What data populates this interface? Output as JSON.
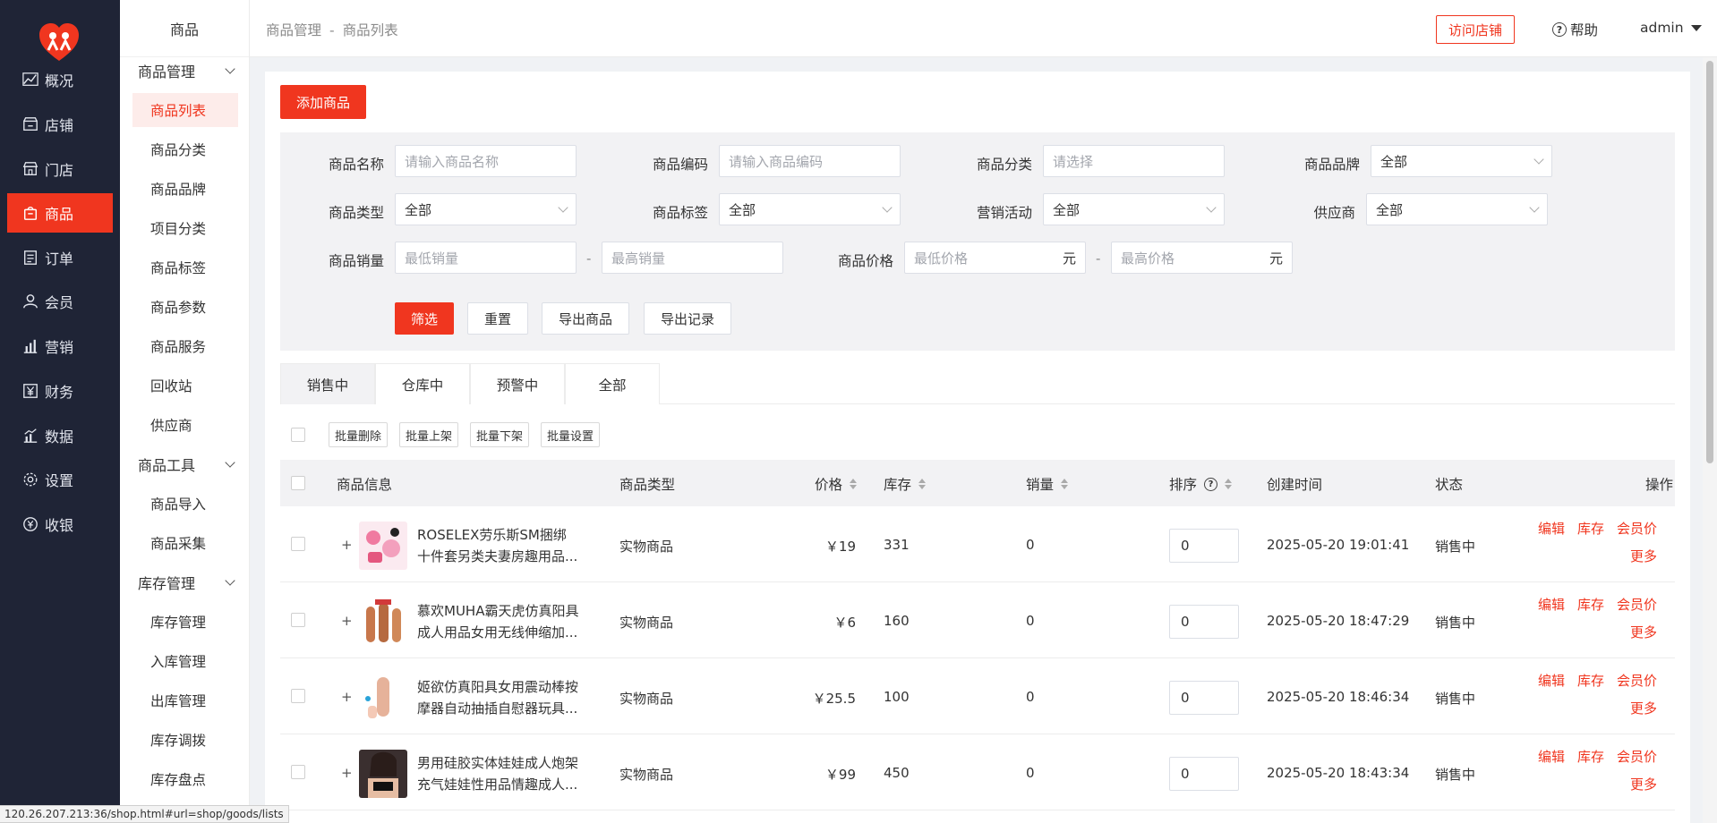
{
  "nav": {
    "items": [
      {
        "label": "概况",
        "icon": "chart-line-icon"
      },
      {
        "label": "店铺",
        "icon": "store-icon"
      },
      {
        "label": "门店",
        "icon": "shop-front-icon"
      },
      {
        "label": "商品",
        "icon": "bag-icon"
      },
      {
        "label": "订单",
        "icon": "order-list-icon"
      },
      {
        "label": "会员",
        "icon": "user-icon"
      },
      {
        "label": "营销",
        "icon": "bar-chart-icon"
      },
      {
        "label": "财务",
        "icon": "yen-icon"
      },
      {
        "label": "数据",
        "icon": "data-icon"
      },
      {
        "label": "设置",
        "icon": "gear-icon"
      },
      {
        "label": "收银",
        "icon": "cashier-icon"
      }
    ],
    "active_index": 3,
    "accent": "#f0361f",
    "background": "#1f2436"
  },
  "subnav": {
    "title": "商品",
    "groups": [
      {
        "label": "商品管理",
        "items": [
          "商品列表",
          "商品分类",
          "商品品牌",
          "项目分类",
          "商品标签",
          "商品参数",
          "商品服务",
          "回收站",
          "供应商"
        ]
      },
      {
        "label": "商品工具",
        "items": [
          "商品导入",
          "商品采集"
        ]
      },
      {
        "label": "库存管理",
        "items": [
          "库存管理",
          "入库管理",
          "出库管理",
          "库存调拨",
          "库存盘点"
        ]
      }
    ],
    "active_item": "商品列表"
  },
  "topbar": {
    "breadcrumb": [
      "商品管理",
      "商品列表"
    ],
    "breadcrumb_sep": "-",
    "visit_store": "访问店铺",
    "help": "帮助",
    "user": "admin"
  },
  "actions": {
    "add_goods": "添加商品"
  },
  "filter": {
    "name": {
      "label": "商品名称",
      "placeholder": "请输入商品名称"
    },
    "code": {
      "label": "商品编码",
      "placeholder": "请输入商品编码"
    },
    "category": {
      "label": "商品分类",
      "placeholder": "请选择"
    },
    "brand": {
      "label": "商品品牌",
      "value": "全部"
    },
    "type": {
      "label": "商品类型",
      "value": "全部"
    },
    "tag": {
      "label": "商品标签",
      "value": "全部"
    },
    "promotion": {
      "label": "营销活动",
      "value": "全部"
    },
    "supplier": {
      "label": "供应商",
      "value": "全部"
    },
    "sales": {
      "label": "商品销量",
      "min_placeholder": "最低销量",
      "max_placeholder": "最高销量"
    },
    "price": {
      "label": "商品价格",
      "min_placeholder": "最低价格",
      "max_placeholder": "最高价格",
      "unit": "元"
    },
    "range_sep": "-",
    "buttons": {
      "filter": "筛选",
      "reset": "重置",
      "export_goods": "导出商品",
      "export_records": "导出记录"
    }
  },
  "tabs": [
    "销售中",
    "仓库中",
    "预警中",
    "全部"
  ],
  "active_tab": "销售中",
  "batch": [
    "批量删除",
    "批量上架",
    "批量下架",
    "批量设置"
  ],
  "table": {
    "headers": {
      "info": "商品信息",
      "type": "商品类型",
      "price": "价格",
      "stock": "库存",
      "sales": "销量",
      "sort": "排序",
      "created": "创建时间",
      "status": "状态",
      "ops": "操作"
    },
    "rows": [
      {
        "name_line1": "ROSELEX劳乐斯SM捆绑",
        "name_line2": "十件套另类夫妻房趣用品...",
        "type": "实物商品",
        "price": "￥19",
        "stock": "331",
        "sales": "0",
        "sort": "0",
        "created": "2025-05-20 19:01:41",
        "status": "销售中"
      },
      {
        "name_line1": "慕欢MUHA霸天虎仿真阳具",
        "name_line2": "成人用品女用无线伸缩加...",
        "type": "实物商品",
        "price": "￥6",
        "stock": "160",
        "sales": "0",
        "sort": "0",
        "created": "2025-05-20 18:47:29",
        "status": "销售中"
      },
      {
        "name_line1": "姬欲仿真阳具女用震动棒按",
        "name_line2": "摩器自动抽插自慰器玩具...",
        "type": "实物商品",
        "price": "￥25.5",
        "stock": "100",
        "sales": "0",
        "sort": "0",
        "created": "2025-05-20 18:46:34",
        "status": "销售中"
      },
      {
        "name_line1": "男用硅胶实体娃娃成人炮架",
        "name_line2": "充气娃娃性用品情趣成人...",
        "type": "实物商品",
        "price": "￥99",
        "stock": "450",
        "sales": "0",
        "sort": "0",
        "created": "2025-05-20 18:43:34",
        "status": "销售中"
      }
    ],
    "row_ops": {
      "edit": "编辑",
      "stock": "库存",
      "member_price": "会员价",
      "more": "更多"
    }
  },
  "status_url": "120.26.207.213:36/shop.html#url=shop/goods/lists"
}
